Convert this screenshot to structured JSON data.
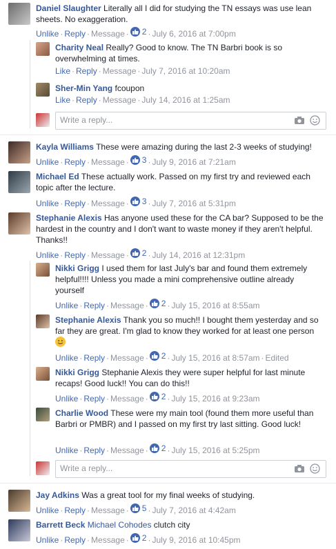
{
  "comments": [
    {
      "author": "Daniel Slaughter",
      "text": "Literally all I did for studying the TN essays was use lean sheets. No exaggeration.",
      "actions": [
        "Unlike",
        "Reply",
        "Message"
      ],
      "likes": "2",
      "time": "July 6, 2016 at 7:00pm",
      "replies": [
        {
          "author": "Charity Neal",
          "text": "Really? Good to know. The TN Barbri book is so overwhelming at times.",
          "actions": [
            "Like",
            "Reply",
            "Message"
          ],
          "time": "July 7, 2016 at 10:20am"
        },
        {
          "author": "Sher-Min Yang",
          "text": "fcoupon",
          "actions": [
            "Like",
            "Reply",
            "Message"
          ],
          "time": "July 14, 2016 at 1:25am"
        }
      ]
    },
    {
      "author": "Kayla Williams",
      "text": "These were amazing during the last 2-3 weeks of studying!",
      "actions": [
        "Unlike",
        "Reply",
        "Message"
      ],
      "likes": "3",
      "time": "July 9, 2016 at 7:21am"
    },
    {
      "author": "Michael Ed",
      "text": "These actually work. Passed on my first try and reviewed each topic after the lecture.",
      "actions": [
        "Unlike",
        "Reply",
        "Message"
      ],
      "likes": "3",
      "time": "July 7, 2016 at 5:31pm"
    },
    {
      "author": "Stephanie Alexis",
      "text": "Has anyone used these for the CA bar? Supposed to be the hardest in the country and I don't want to waste money if they aren't helpful. Thanks!!",
      "actions": [
        "Unlike",
        "Reply",
        "Message"
      ],
      "likes": "2",
      "time": "July 14, 2016 at 12:31pm",
      "replies": [
        {
          "author": "Nikki Grigg",
          "text": "I used them for last July's bar and found them extremely helpful!!!! Unless you made a mini comprehensive outline already yourself",
          "actions": [
            "Unlike",
            "Reply",
            "Message"
          ],
          "likes": "2",
          "time": "July 15, 2016 at 8:55am"
        },
        {
          "author": "Stephanie Alexis",
          "text": "Thank you so much!! I bought them yesterday and so far they are great. I'm glad to know they worked for at least one person",
          "actions": [
            "Unlike",
            "Reply",
            "Message"
          ],
          "likes": "2",
          "time": "July 15, 2016 at 8:57am",
          "edited": "Edited"
        },
        {
          "author": "Nikki Grigg",
          "tag": "Stephanie Alexis",
          "text": "they were super helpful for last minute recaps! Good luck!! You can do this!!",
          "actions": [
            "Unlike",
            "Reply",
            "Message"
          ],
          "likes": "2",
          "time": "July 15, 2016 at 9:23am"
        },
        {
          "author": "Charlie Wood",
          "text": "These were my main tool (found them more useful than Barbri or PMBR) and I passed on my first try last sitting. Good luck!",
          "actions": [
            "Unlike",
            "Reply",
            "Message"
          ],
          "likes": "2",
          "time": "July 15, 2016 at 5:25pm"
        }
      ]
    },
    {
      "author": "Jay Adkins",
      "text": "Was a great tool for my final weeks of studying.",
      "actions": [
        "Unlike",
        "Reply",
        "Message"
      ],
      "likes": "5",
      "time": "July 7, 2016 at 4:42am"
    },
    {
      "author": "Barrett Beck",
      "tag": "Michael Cohodes",
      "text": "clutch city",
      "actions": [
        "Unlike",
        "Reply",
        "Message"
      ],
      "likes": "2",
      "time": "July 9, 2016 at 10:45pm"
    }
  ],
  "reply_placeholder": "Write a reply...",
  "icons": {
    "like": "thumbs-up-icon",
    "camera": "camera-icon",
    "emoji": "emoji-icon"
  },
  "colors": {
    "link": "#365899",
    "action": "#4267b2",
    "meta": "#90949c"
  }
}
